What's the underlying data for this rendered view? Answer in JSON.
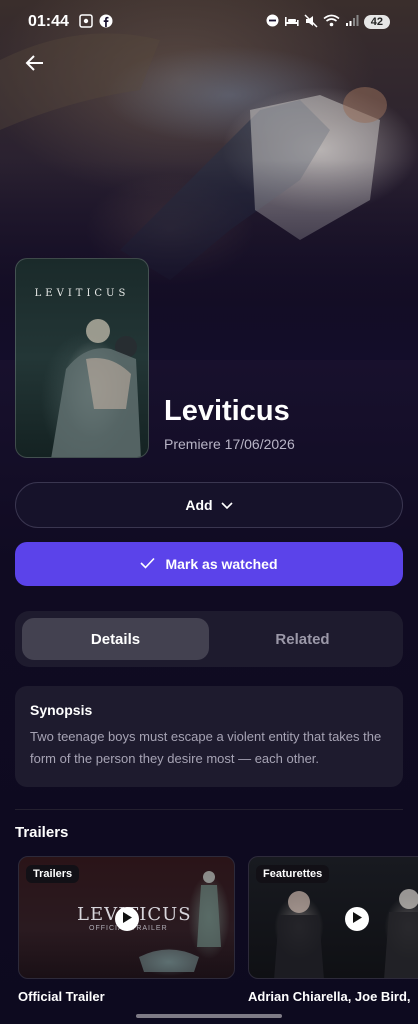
{
  "status_bar": {
    "time": "01:44",
    "battery": "42",
    "left_icons": [
      "screenshot-icon",
      "facebook-icon"
    ],
    "right_icons": [
      "dnd-icon",
      "bed-icon",
      "mute-icon",
      "wifi-icon",
      "signal-icon"
    ]
  },
  "movie": {
    "poster_title": "LEVITICUS",
    "title": "Leviticus",
    "premiere": "Premiere 17/06/2026"
  },
  "actions": {
    "add_label": "Add",
    "watched_label": "Mark as watched"
  },
  "tabs": [
    {
      "label": "Details",
      "active": true
    },
    {
      "label": "Related",
      "active": false
    }
  ],
  "synopsis": {
    "title": "Synopsis",
    "text": "Two teenage boys must escape a violent entity that takes the form of the person they desire most — each other."
  },
  "trailers": {
    "section_title": "Trailers",
    "items": [
      {
        "badge": "Trailers",
        "caption": "Official Trailer",
        "overlay": "LEVITICUS",
        "overlay_sub": "OFFICIAL TRAILER"
      },
      {
        "badge": "Featurettes",
        "caption": "Adrian Chiarella, Joe Bird,"
      }
    ]
  },
  "colors": {
    "accent": "#5b43ea",
    "surface": "#1e1b2e",
    "background": "#0d0a1f"
  }
}
